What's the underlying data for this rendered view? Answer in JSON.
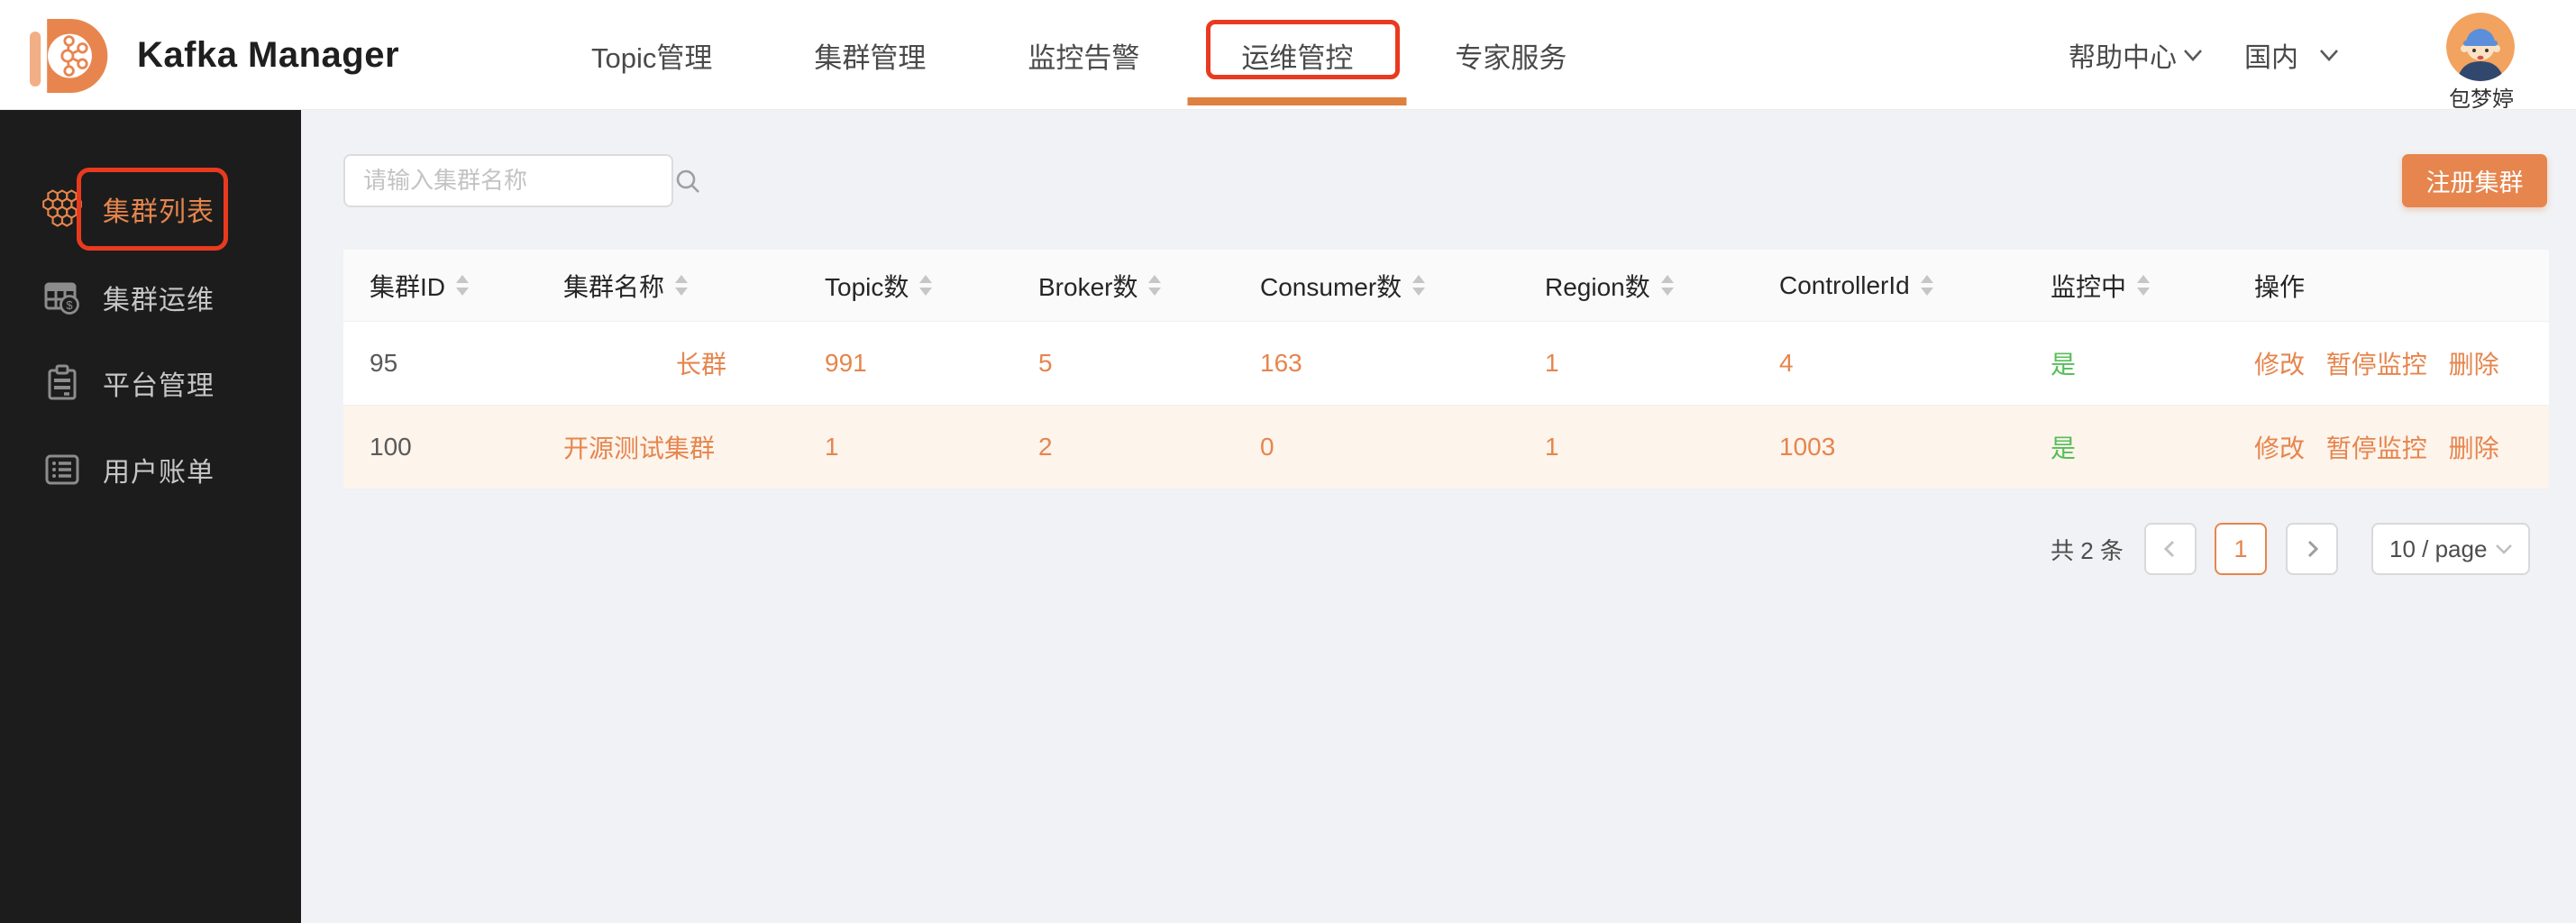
{
  "colors": {
    "accent": "#E6854D",
    "accent-deep": "#DE8040",
    "green": "#56BE58",
    "annotation-red": "#E93A20",
    "sidebar-bg": "#1C1C1C",
    "page-bg": "#F0F2F5",
    "row-highlight": "#FDF4EC"
  },
  "header": {
    "title": "Kafka Manager",
    "nav_items": [
      {
        "label": "Topic管理",
        "active": false
      },
      {
        "label": "集群管理",
        "active": false
      },
      {
        "label": "监控告警",
        "active": false
      },
      {
        "label": "运维管控",
        "active": true
      },
      {
        "label": "专家服务",
        "active": false
      }
    ],
    "help_label": "帮助中心",
    "region_label": "国内",
    "user_name": "包梦婷"
  },
  "sidebar": {
    "items": [
      {
        "label": "集群列表",
        "icon": "honeycomb-cluster-icon",
        "active": true
      },
      {
        "label": "集群运维",
        "icon": "billing-table-icon",
        "active": false
      },
      {
        "label": "平台管理",
        "icon": "clipboard-icon",
        "active": false
      },
      {
        "label": "用户账单",
        "icon": "list-icon",
        "active": false
      }
    ]
  },
  "toolbar": {
    "search_placeholder": "请输入集群名称",
    "register_button": "注册集群"
  },
  "table": {
    "columns": [
      {
        "label": "集群ID",
        "sortable": true
      },
      {
        "label": "集群名称",
        "sortable": true
      },
      {
        "label": "Topic数",
        "sortable": true
      },
      {
        "label": "Broker数",
        "sortable": true
      },
      {
        "label": "Consumer数",
        "sortable": true
      },
      {
        "label": "Region数",
        "sortable": true
      },
      {
        "label": "ControllerId",
        "sortable": true
      },
      {
        "label": "监控中",
        "sortable": true
      },
      {
        "label": "操作",
        "sortable": false
      }
    ],
    "rows": [
      {
        "id": "95",
        "name": "长群",
        "topics": "991",
        "brokers": "5",
        "consumers": "163",
        "regions": "1",
        "controller_id": "4",
        "monitored": "是",
        "actions": [
          "修改",
          "暂停监控",
          "删除"
        ]
      },
      {
        "id": "100",
        "name": "开源测试集群",
        "topics": "1",
        "brokers": "2",
        "consumers": "0",
        "regions": "1",
        "controller_id": "1003",
        "monitored": "是",
        "actions": [
          "修改",
          "暂停监控",
          "删除"
        ]
      }
    ]
  },
  "pagination": {
    "total_label": "共 2 条",
    "current_page": "1",
    "page_size_label": "10 / page"
  }
}
